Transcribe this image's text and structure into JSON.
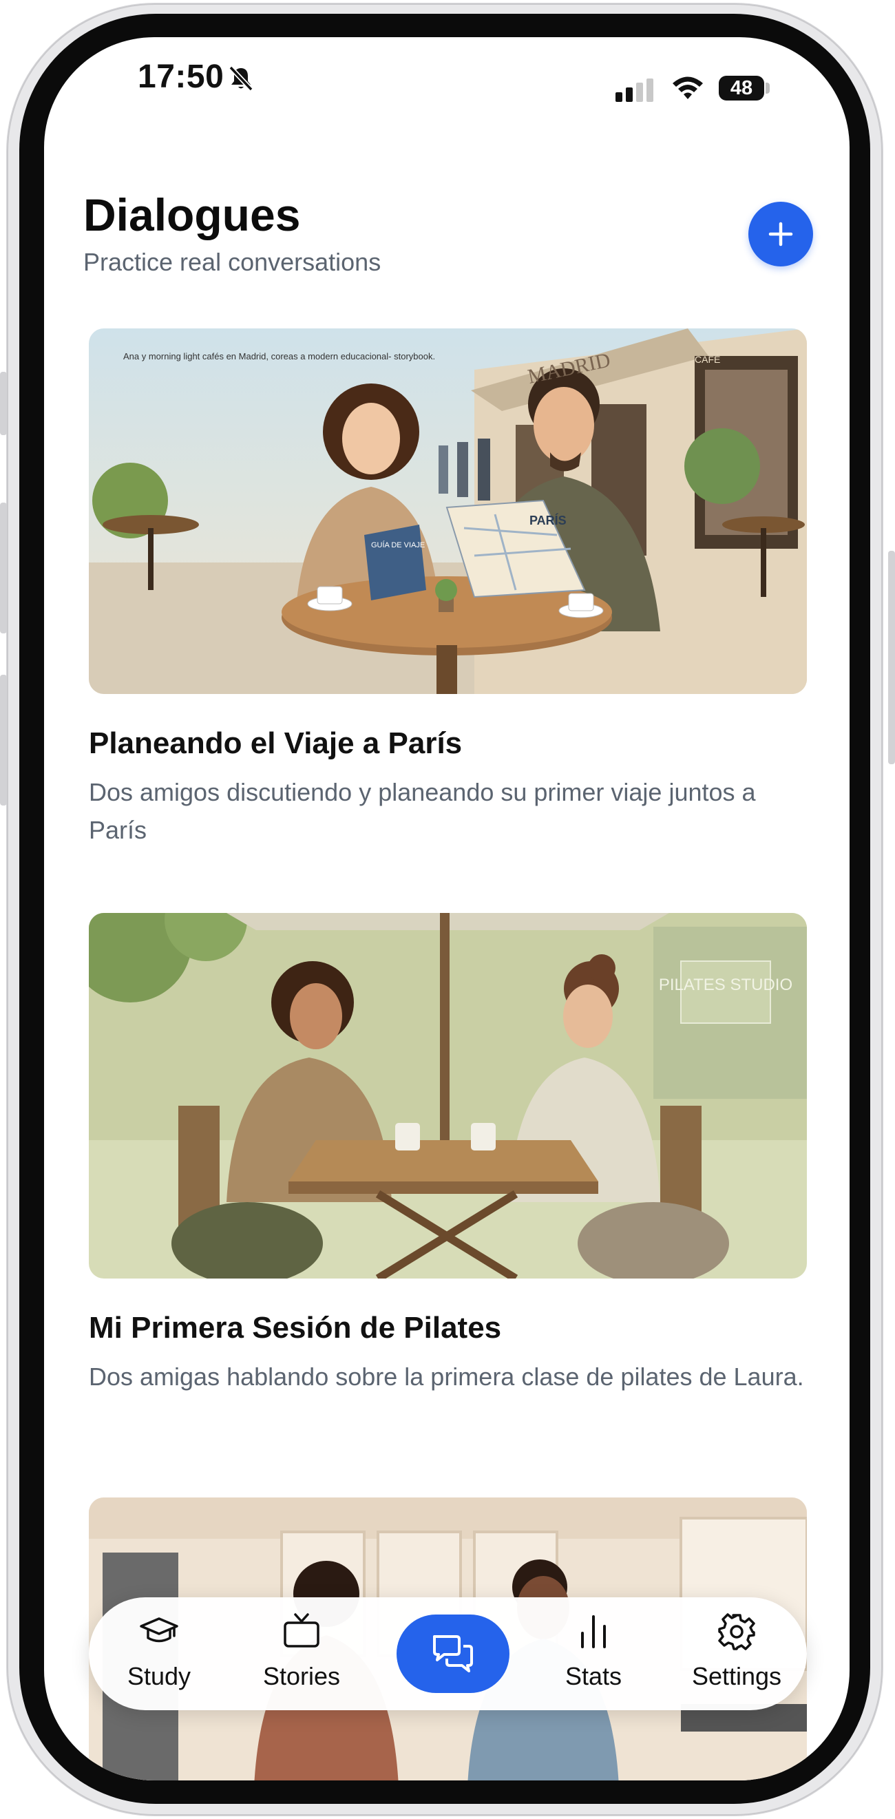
{
  "status": {
    "time": "17:50",
    "battery": "48"
  },
  "header": {
    "title": "Dialogues",
    "subtitle": "Practice real conversations"
  },
  "dialogues": [
    {
      "title": "Planeando el Viaje a París",
      "description": "Dos amigos discutiendo y planeando su primer viaje juntos a París",
      "image_caption": "Ana y morning light cafés en Madrid, coreas a modern educacional- storybook.",
      "sign_text": "MADRID",
      "cafe_sign": "CAFÉ",
      "book_text": "GUÍA DE VIAJE",
      "map_text": "PARÍS"
    },
    {
      "title": "Mi Primera Sesión de Pilates",
      "description": "Dos amigas hablando sobre la primera clase de pilates de Laura.",
      "sign_text": "PILATES STUDIO"
    },
    {
      "title": "",
      "description": ""
    }
  ],
  "nav": {
    "items": [
      {
        "label": "Study",
        "icon": "graduation-cap-icon"
      },
      {
        "label": "Stories",
        "icon": "tv-icon"
      },
      {
        "label": "",
        "icon": "chat-bubbles-icon"
      },
      {
        "label": "Stats",
        "icon": "bar-chart-icon"
      },
      {
        "label": "Settings",
        "icon": "gear-icon"
      }
    ]
  },
  "colors": {
    "accent": "#2563eb",
    "subtitle": "#5b6470"
  }
}
